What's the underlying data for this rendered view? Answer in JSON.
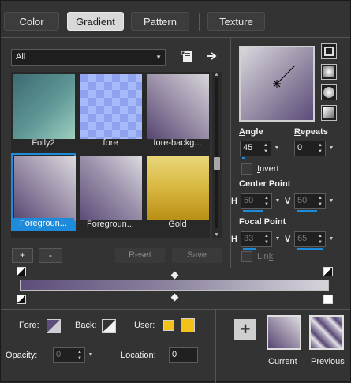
{
  "tabs": [
    {
      "label": "Color",
      "active": false
    },
    {
      "label": "Gradient",
      "active": true
    },
    {
      "label": "Pattern",
      "active": false
    },
    {
      "label": "Texture",
      "active": false
    }
  ],
  "category": {
    "selected": "All"
  },
  "swatches": [
    {
      "label": "Folly2",
      "selected": false
    },
    {
      "label": "fore",
      "selected": false
    },
    {
      "label": "fore-backg...",
      "selected": false
    },
    {
      "label": "Foregroun...",
      "selected": true
    },
    {
      "label": "Foregroun...",
      "selected": false
    },
    {
      "label": "Gold",
      "selected": false
    }
  ],
  "list_buttons": {
    "add": "+",
    "remove": "-",
    "reset": "Reset",
    "save": "Save"
  },
  "angle": {
    "label_pre": "",
    "label_ul": "A",
    "label_post": "ngle",
    "value": "45"
  },
  "repeats": {
    "label_ul": "R",
    "label_post": "epeats",
    "value": "0"
  },
  "invert": {
    "label_ul": "I",
    "label_post": "nvert",
    "checked": false
  },
  "center_point": {
    "title": "Center Point",
    "h_label": "H",
    "h_value": "50",
    "v_label": "V",
    "v_value": "50"
  },
  "focal_point": {
    "title": "Focal Point",
    "h_label": "H",
    "h_value": "33",
    "v_label": "V",
    "v_value": "65"
  },
  "link": {
    "label_pre": "Lin",
    "label_ul": "k",
    "checked": false
  },
  "fore": {
    "label_ul": "F",
    "label_post": "ore:"
  },
  "back": {
    "label_ul": "B",
    "label_post": "ack:"
  },
  "user": {
    "label_ul": "U",
    "label_post": "ser:"
  },
  "opacity": {
    "label_ul": "O",
    "label_post": "pacity:",
    "value": "0"
  },
  "location": {
    "label_ul": "L",
    "label_post": "ocation:",
    "value": "0"
  },
  "current": {
    "label": "Current"
  },
  "previous": {
    "label": "Previous"
  },
  "colors": {
    "accent": "#1d8bd9",
    "gradient_start": "#5c4d7a",
    "gradient_end": "#d8d4dc",
    "user": "#f2c21b"
  }
}
